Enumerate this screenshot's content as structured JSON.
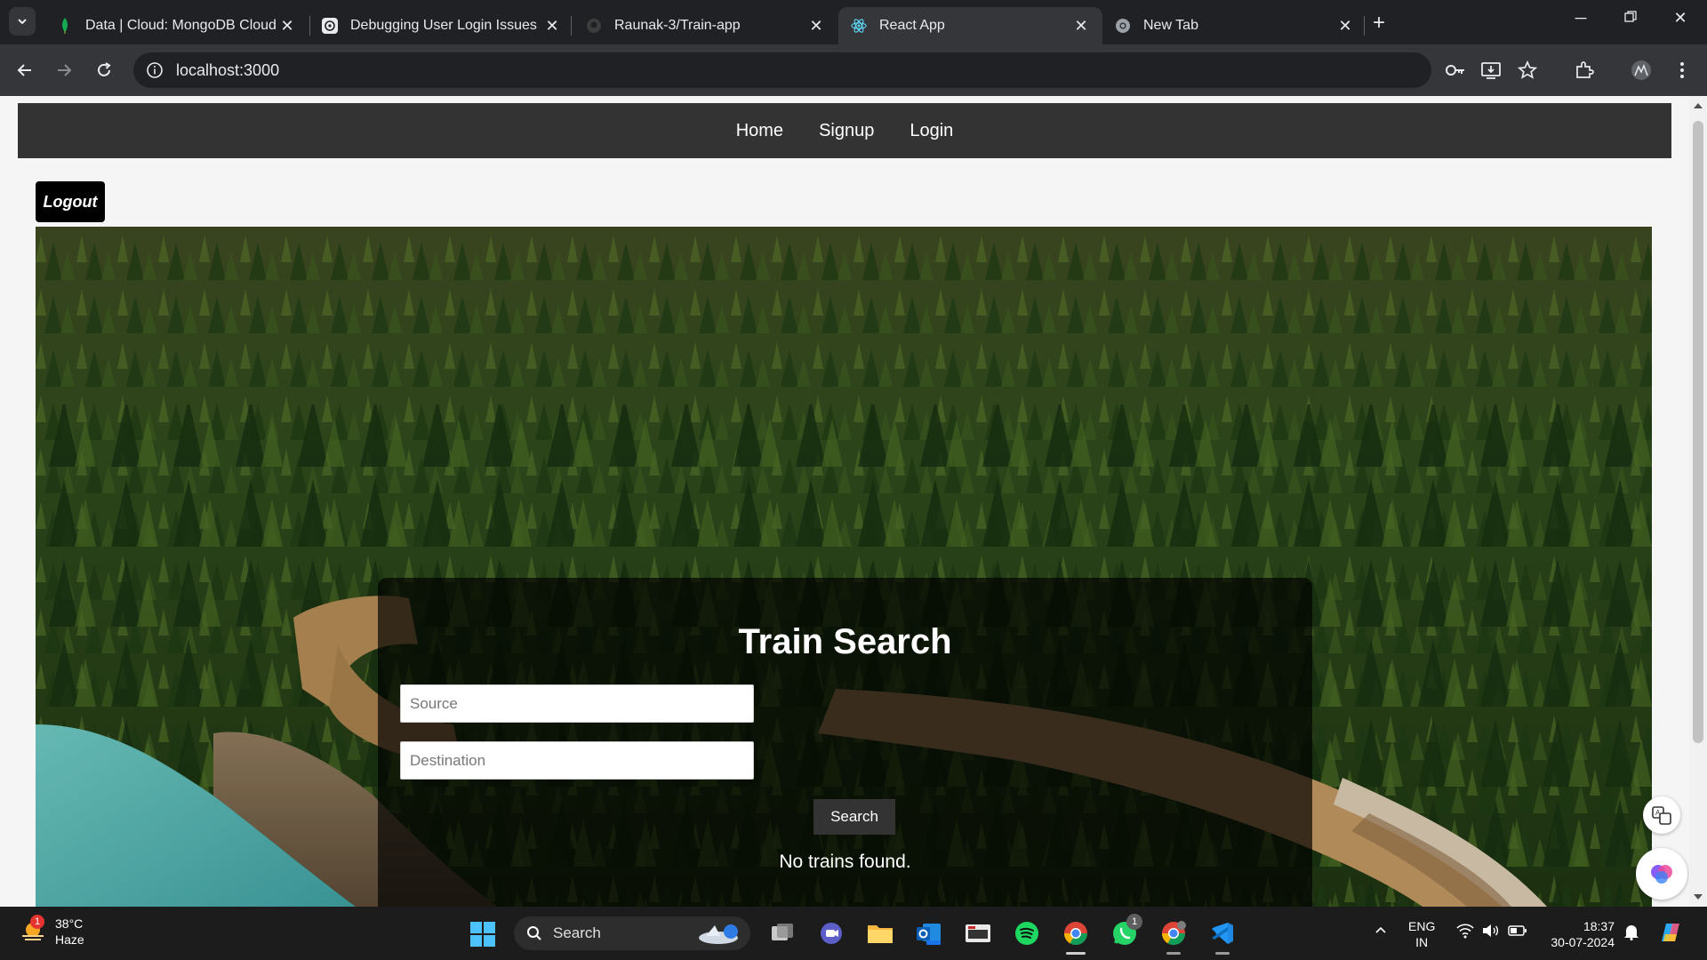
{
  "browser": {
    "tabs": [
      {
        "title": "Data | Cloud: MongoDB Cloud",
        "favicon": "mongodb-leaf-icon",
        "active": false
      },
      {
        "title": "Debugging User Login Issues",
        "favicon": "chatgpt-icon",
        "active": false
      },
      {
        "title": "Raunak-3/Train-app",
        "favicon": "github-icon",
        "active": false
      },
      {
        "title": "React App",
        "favicon": "react-icon",
        "active": true
      },
      {
        "title": "New Tab",
        "favicon": "chrome-icon",
        "active": false
      }
    ],
    "url": "localhost:3000",
    "colors": {
      "tabstrip": "#202124",
      "toolbar": "#35363a"
    }
  },
  "site": {
    "nav": {
      "home": "Home",
      "signup": "Signup",
      "login": "Login"
    },
    "logout_label": "Logout",
    "search_card": {
      "title": "Train Search",
      "source_placeholder": "Source",
      "destination_placeholder": "Destination",
      "search_label": "Search",
      "result_message": "No trains found."
    }
  },
  "taskbar": {
    "weather": {
      "temp": "38°C",
      "condition": "Haze",
      "badge": "1"
    },
    "search_label": "Search",
    "whatsapp_badge": "1",
    "language": {
      "line1": "ENG",
      "line2": "IN"
    },
    "clock": {
      "time": "18:37",
      "date": "30-07-2024"
    }
  }
}
